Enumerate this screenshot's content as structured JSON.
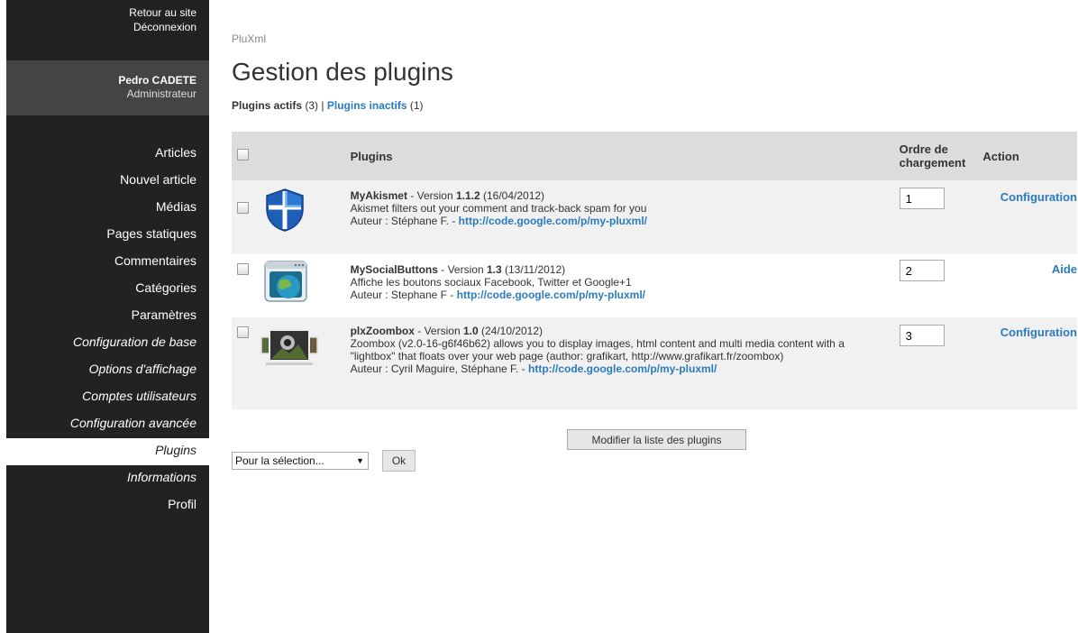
{
  "sidebar": {
    "top_links": [
      "Retour au site",
      "Déconnexion"
    ],
    "user": {
      "name": "Pedro CADETE",
      "role": "Administrateur"
    },
    "menu": [
      {
        "label": "Articles"
      },
      {
        "label": "Nouvel article"
      },
      {
        "label": "Médias"
      },
      {
        "label": "Pages statiques"
      },
      {
        "label": "Commentaires"
      },
      {
        "label": "Catégories"
      },
      {
        "label": "Paramètres"
      },
      {
        "label": "Configuration de base"
      },
      {
        "label": "Options d'affichage"
      },
      {
        "label": "Comptes utilisateurs"
      },
      {
        "label": "Configuration avancée"
      },
      {
        "label": "Plugins"
      },
      {
        "label": "Informations"
      },
      {
        "label": "Profil"
      }
    ]
  },
  "breadcrumb": "PluXml",
  "page_title": "Gestion des plugins",
  "filters": {
    "active_label": "Plugins actifs",
    "active_count": "(3)",
    "separator": "|",
    "inactive_label": "Plugins inactifs",
    "inactive_count": "(1)"
  },
  "table": {
    "headers": {
      "plugins": "Plugins",
      "order_line1": "Ordre de",
      "order_line2": "chargement",
      "action": "Action"
    },
    "rows": [
      {
        "name": "MyAkismet",
        "version_prefix": " - Version ",
        "version": "1.1.2",
        "date": " (16/04/2012)",
        "description": "Akismet filters out your comment and track-back spam for you",
        "author": "Auteur : Stéphane F. - ",
        "url": "http://code.google.com/p/my-pluxml/",
        "order": "1",
        "action": "Configuration",
        "icon": "shield-icon"
      },
      {
        "name": "MySocialButtons",
        "version_prefix": " - Version ",
        "version": "1.3",
        "date": " (13/11/2012)",
        "description": "Affiche les boutons sociaux Facebook, Twitter et Google+1",
        "author": "Auteur : Stephane F - ",
        "url": "http://code.google.com/p/my-pluxml/",
        "order": "2",
        "action": "Aide",
        "icon": "globe-window-icon"
      },
      {
        "name": "plxZoombox",
        "version_prefix": " - Version ",
        "version": "1.0",
        "date": " (24/10/2012)",
        "description": "Zoombox (v2.0-16-g6f46b62) allows you to display images, html content and multi media content with a \"lightbox\" that floats over your web page (author: grafikart, http://www.grafikart.fr/zoombox)",
        "author": "Auteur : Cyril Maguire, Stéphane F. - ",
        "url": "http://code.google.com/p/my-pluxml/",
        "order": "3",
        "action": "Configuration",
        "icon": "photo-stack-icon"
      }
    ]
  },
  "buttons": {
    "modify": "Modifier la liste des plugins",
    "selection": "Pour la sélection...",
    "ok": "Ok"
  },
  "colors": {
    "sidebar_bg": "#222222",
    "link": "#2a7bbf",
    "header_bg": "#dcdcdc"
  }
}
